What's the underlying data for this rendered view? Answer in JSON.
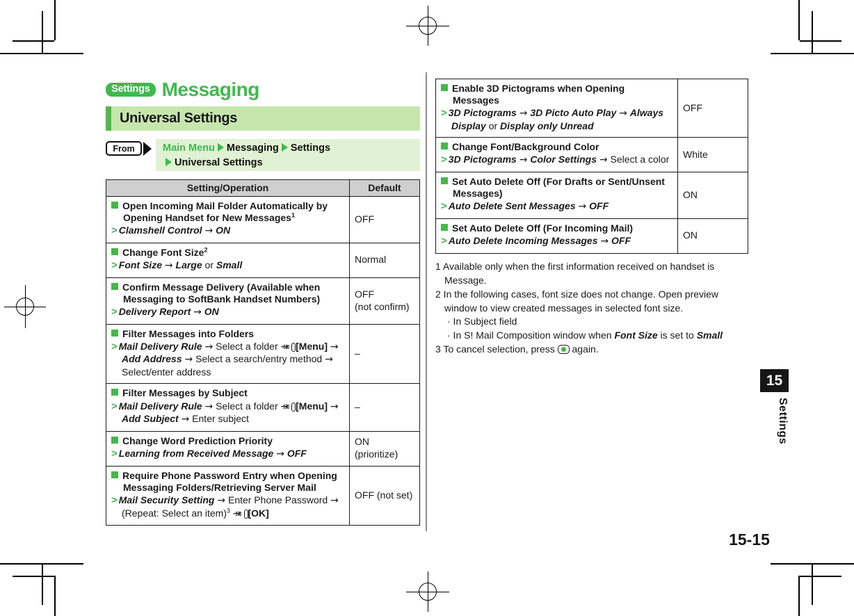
{
  "header": {
    "badge": "Settings",
    "title": "Messaging",
    "subhead": "Universal Settings"
  },
  "breadcrumb": {
    "from_label": "From",
    "part1": "Main Menu",
    "part2": "Messaging",
    "part3": "Settings",
    "part4": "Universal Settings"
  },
  "table": {
    "headers": {
      "operation": "Setting/Operation",
      "default": "Default"
    }
  },
  "left_rows": [
    {
      "heading": "Open Incoming Mail Folder Automatically by Opening Handset for New Messages",
      "heading_sup": "1",
      "operation_html": "<span class=\"gt\">&gt;</span><span class=\"it\">Clamshell Control</span> <span class=\"arr\">→</span> <span class=\"it\">ON</span>",
      "default": "OFF"
    },
    {
      "heading": "Change Font Size",
      "heading_sup": "2",
      "operation_html": "<span class=\"gt\">&gt;</span><span class=\"it\">Font Size</span> <span class=\"arr\">→</span> <span class=\"it\">Large</span> or <span class=\"it\">Small</span>",
      "default": "Normal"
    },
    {
      "heading": "Confirm Message Delivery (Available when Messaging to SoftBank Handset Numbers)",
      "heading_sup": "",
      "operation_html": "<span class=\"gt\">&gt;</span><span class=\"it\">Delivery Report</span> <span class=\"arr\">→</span> <span class=\"it\">ON</span>",
      "default": "OFF\n(not confirm)"
    },
    {
      "heading": "Filter Messages into Folders",
      "heading_sup": "",
      "operation_html": "<span class=\"gt\">&gt;</span><span class=\"it\">Mail Delivery Rule</span> <span class=\"arr\">→</span> Select a folder <span class=\"arr\">→</span> <span class=\"env-icon\">✉</span><span class=\"bd\">[Menu]</span> <span class=\"arr\">→</span> <span class=\"it\">Add Address</span> <span class=\"arr\">→</span> Select a search/entry method <span class=\"arr\">→</span> Select/enter address",
      "default": "–"
    },
    {
      "heading": "Filter Messages by Subject",
      "heading_sup": "",
      "operation_html": "<span class=\"gt\">&gt;</span><span class=\"it\">Mail Delivery Rule</span> <span class=\"arr\">→</span> Select a folder <span class=\"arr\">→</span> <span class=\"env-icon\">✉</span><span class=\"bd\">[Menu]</span> <span class=\"arr\">→</span> <span class=\"it\">Add Subject</span> <span class=\"arr\">→</span> Enter subject",
      "default": "–"
    },
    {
      "heading": "Change Word Prediction Priority",
      "heading_sup": "",
      "operation_html": "<span class=\"gt\">&gt;</span><span class=\"it\">Learning from Received Message</span> <span class=\"arr\">→</span> <span class=\"it\">OFF</span>",
      "default": "ON (prioritize)"
    },
    {
      "heading": "Require Phone Password Entry when Opening Messaging Folders/Retrieving Server Mail",
      "heading_sup": "",
      "operation_html": "<span class=\"gt\">&gt;</span><span class=\"it\">Mail Security Setting</span> <span class=\"arr\">→</span> Enter Phone Password <span class=\"arr\">→</span> (Repeat: Select an item)<sup>3</sup> <span class=\"arr\">→</span> <span class=\"env-icon\">✉</span><span class=\"bd\">[OK]</span>",
      "default": "OFF (not set)"
    }
  ],
  "right_rows": [
    {
      "heading": "Enable 3D Pictograms when Opening Messages",
      "heading_sup": "",
      "operation_html": "<span class=\"gt\">&gt;</span><span class=\"it\">3D Pictograms</span> <span class=\"arr\">→</span> <span class=\"it\">3D Picto Auto Play</span> <span class=\"arr\">→</span> <span class=\"it\">Always Display</span> or <span class=\"it\">Display only Unread</span>",
      "default": "OFF"
    },
    {
      "heading": "Change Font/Background Color",
      "heading_sup": "",
      "operation_html": "<span class=\"gt\">&gt;</span><span class=\"it\">3D Pictograms</span> <span class=\"arr\">→</span> <span class=\"it\">Color Settings</span> <span class=\"arr\">→</span> Select a color",
      "default": "White"
    },
    {
      "heading": "Set Auto Delete Off (For Drafts or Sent/Unsent Messages)",
      "heading_sup": "",
      "operation_html": "<span class=\"gt\">&gt;</span><span class=\"it\">Auto Delete Sent Messages</span> <span class=\"arr\">→</span> <span class=\"it\">OFF</span>",
      "default": "ON"
    },
    {
      "heading": "Set Auto Delete Off (For Incoming Mail)",
      "heading_sup": "",
      "operation_html": "<span class=\"gt\">&gt;</span><span class=\"it\">Auto Delete Incoming Messages</span> <span class=\"arr\">→</span> <span class=\"it\">OFF</span>",
      "default": "ON"
    }
  ],
  "footnotes": [
    {
      "num": "1",
      "text": "Available only when the first information received on handset is Message.",
      "html": "1 Available only when the first information received on handset is Message."
    },
    {
      "num": "2",
      "text": "In the following cases, font size does not change. Open preview window to view created messages in selected font size.",
      "html": "2 In the following cases, font size does not change. Open preview window to view created messages in selected font size."
    },
    {
      "num": "",
      "text": "· In Subject field",
      "html": "· In Subject field"
    },
    {
      "num": "",
      "text": "· In S! Mail Composition window when Font Size is set to Small",
      "html": "· In S! Mail Composition window when <span class=\"it\">Font Size</span> is set to <span class=\"it\">Small</span>"
    },
    {
      "num": "3",
      "text": "To cancel selection, press ◉ again.",
      "html": "3 To cancel selection, press <span class=\"ok-icon\"></span> again."
    }
  ],
  "sidetab": {
    "chapter_number": "15",
    "chapter_label": "Settings"
  },
  "folio": "15-15",
  "colors": {
    "brand_green": "#3dba4e",
    "light_green_band": "#c7e6ae",
    "path_band": "#e0f2d3",
    "table_header_gray": "#cfcfcf",
    "square_green": "#46b74a",
    "black": "#161616"
  }
}
